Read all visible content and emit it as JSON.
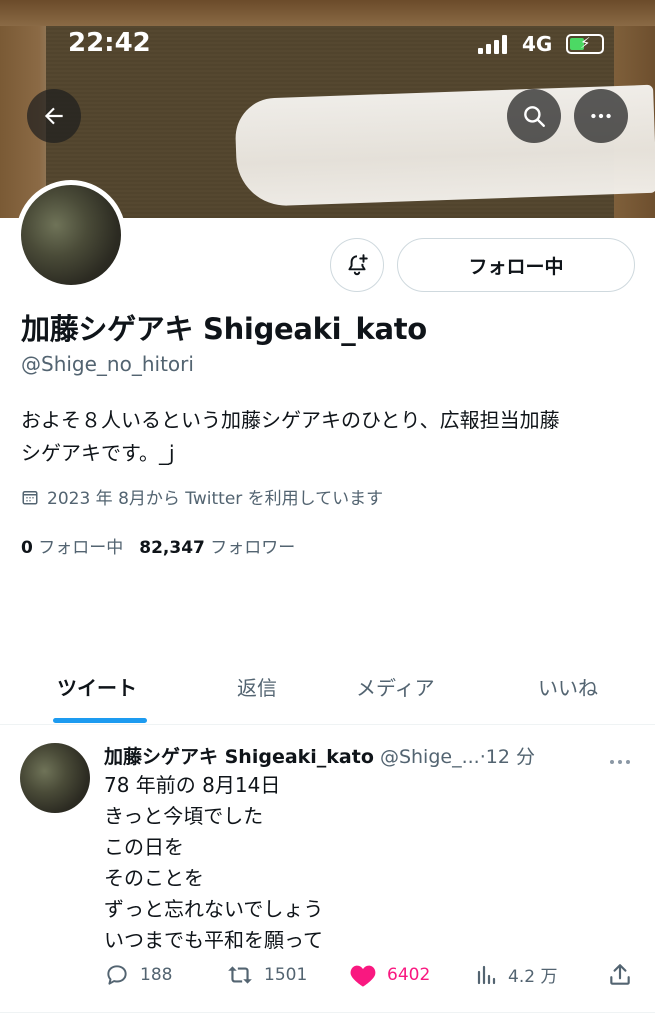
{
  "status_bar": {
    "time": "22:42",
    "network": "4G"
  },
  "header": {
    "back_icon": "arrow-left-icon",
    "search_icon": "search-icon",
    "more_icon": "more-horizontal-icon"
  },
  "profile": {
    "follow_button_label": "フォロー中",
    "notify_icon": "bell-plus-icon",
    "display_name": "加藤シゲアキ Shigeaki_kato",
    "handle": "@Shige_no_hitori",
    "bio_line1": "およそ８人いるという加藤シゲアキのひとり、広報担当加藤",
    "bio_line2": "シゲアキです。_j",
    "joined": "2023 年 8月から Twitter を利用しています",
    "following_count": "0",
    "following_label": "フォロー中",
    "followers_count": "82,347",
    "followers_label": "フォロワー"
  },
  "tabs": [
    {
      "label": "ツイート",
      "active": true
    },
    {
      "label": "返信",
      "active": false
    },
    {
      "label": "メディア",
      "active": false
    },
    {
      "label": "いいね",
      "active": false
    }
  ],
  "tweet": {
    "author_name": "加藤シゲアキ Shigeaki_kato",
    "author_handle": "@Shige_...",
    "separator": "·",
    "time": "12 分",
    "lines": [
      "78 年前の 8月14日",
      "きっと今頃でした",
      "この日を",
      "そのことを",
      "ずっと忘れないでしょう",
      "いつまでも平和を願って"
    ],
    "replies": "188",
    "retweets": "1501",
    "likes": "6402",
    "views": "4.2 万"
  },
  "colors": {
    "accent": "#1d9bf0",
    "like": "#f91880",
    "muted": "#536471",
    "text": "#0f1419"
  }
}
